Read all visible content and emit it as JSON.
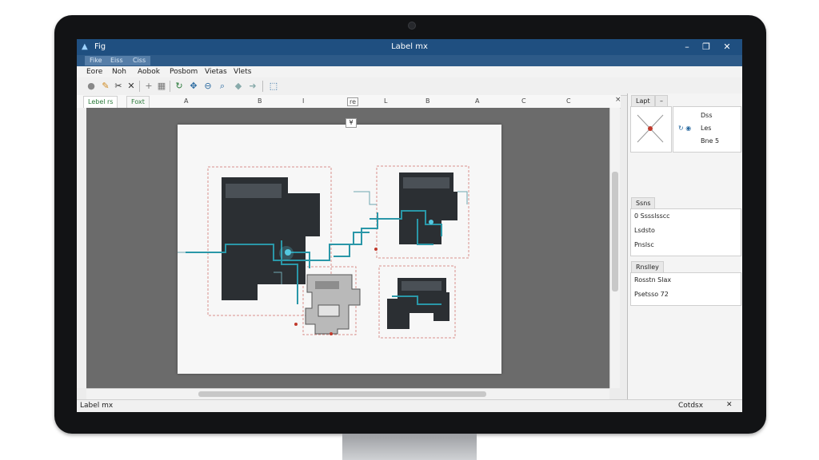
{
  "window": {
    "app_name": "Fig",
    "document_title": "Label mx",
    "buttons": [
      "–",
      "❐",
      "✕"
    ]
  },
  "menu_tabs": [
    "Fike",
    "Eiss",
    "Ciss"
  ],
  "menu": [
    "Eore",
    "Noh",
    "Aobok",
    "Posbom",
    "Vietas",
    "Vlets"
  ],
  "toolbar": {
    "icons": [
      "new-icon",
      "open-icon",
      "cut-icon",
      "close-icon",
      "plus-icon",
      "grid-icon",
      "rotate-icon",
      "move-icon",
      "zoom-out-icon",
      "zoom-icon",
      "back-icon",
      "forward-icon",
      "select-icon"
    ]
  },
  "doc_tabs": [
    "Lebel rs",
    "Foxt"
  ],
  "ruler": {
    "labels": [
      "A",
      "B",
      "I",
      "re",
      "L",
      "B",
      "A",
      "C",
      "C"
    ],
    "close": "×"
  },
  "page_marker": "¥",
  "right_panel": {
    "layout": {
      "tab": "Lapt",
      "subtab": "–",
      "entries": [
        "Dss",
        "Les",
        "Bne 5"
      ]
    },
    "steps": {
      "tab": "Ssns",
      "items": [
        "0 Sssslsscc",
        "Lsdsto",
        "Pnslsc"
      ]
    },
    "reading": {
      "tab": "Rnslley",
      "items": [
        "Rosstn Slax",
        "Psetsso 72"
      ]
    }
  },
  "status": {
    "left": "Label mx",
    "right": "Cotdsx"
  },
  "colors": {
    "titlebar": "#1f4f80",
    "canvas": "#6b6b6b",
    "circuit": "#2a97a8",
    "dark_block": "#2b2f33",
    "frame": "#d9918c"
  }
}
